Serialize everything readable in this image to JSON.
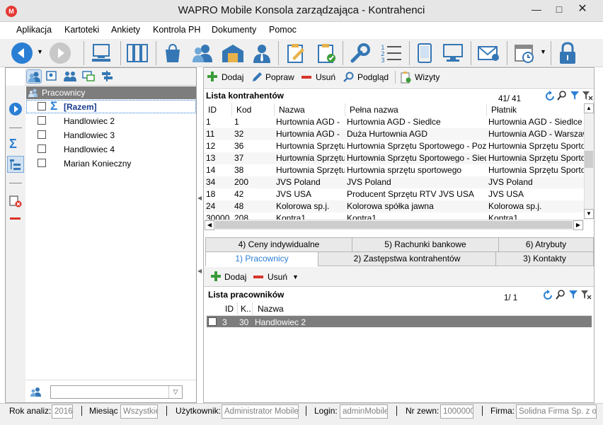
{
  "window": {
    "title": "WAPRO Mobile Konsola zarządzająca - Kontrahenci",
    "logo": "M"
  },
  "menu": [
    "Aplikacja",
    "Kartoteki",
    "Ankiety",
    "Kontrola PH",
    "Dokumenty",
    "Pomoc"
  ],
  "toolbar_icons": [
    "back-icon",
    "forward-icon",
    "terminal-icon",
    "binders-icon",
    "shopping-bag-icon",
    "users-icon",
    "warehouse-icon",
    "user-tie-icon",
    "clipboard-edit-icon",
    "clipboard-check-icon",
    "wrench-icon",
    "numbered-list-icon",
    "mobile-device-icon",
    "computer-icon",
    "mail-user-icon",
    "calendar-clock-icon",
    "lock-icon"
  ],
  "left": {
    "tree_title": "Pracownicy",
    "items": [
      {
        "label": "[Razem]",
        "bold": true
      },
      {
        "label": "Handlowiec 2"
      },
      {
        "label": "Handlowiec 3"
      },
      {
        "label": "Handlowiec 4"
      },
      {
        "label": "Marian Konieczny"
      }
    ],
    "search_value": ""
  },
  "right": {
    "toolbar": {
      "add": "Dodaj",
      "edit": "Popraw",
      "delete": "Usuń",
      "preview": "Podgląd",
      "visits": "Wizyty"
    },
    "contractors": {
      "title": "Lista kontrahentów",
      "count": "41/ 41",
      "columns": [
        "ID",
        "Kod",
        "Nazwa",
        "Pełna nazwa",
        "Płatnik"
      ],
      "rows": [
        [
          "1",
          "1",
          "Hurtownia AGD -",
          "Hurtownia AGD - Siedlce",
          "Hurtownia AGD - Siedlce"
        ],
        [
          "11",
          "32",
          "Hurtownia AGD -",
          "Duża Hurtownia AGD",
          "Hurtownia AGD - Warszawa"
        ],
        [
          "12",
          "36",
          "Hurtownia Sprzętu",
          "Hurtownia Sprzętu Sportowego - Pozn",
          "Hurtownia Sprzętu Sportowe"
        ],
        [
          "13",
          "37",
          "Hurtownia Sprzętu",
          "Hurtownia Sprzętu Sportowego - Siedl",
          "Hurtownia Sprzętu Sportowe"
        ],
        [
          "14",
          "38",
          "Hurtownia Sprzętu",
          "Hurtownia sprzętu sportowego",
          "Hurtownia Sprzętu Sportowe"
        ],
        [
          "34",
          "200",
          "JVS Poland",
          "JVS Poland",
          "JVS Poland"
        ],
        [
          "18",
          "42",
          "JVS USA",
          "Producent Sprzętu RTV JVS USA",
          "JVS USA"
        ],
        [
          "24",
          "48",
          "Kolorowa sp.j.",
          "Kolorowa spółka jawna",
          "Kolorowa sp.j."
        ],
        [
          "30000",
          "208",
          "Kontra1",
          "Kontra1",
          "Kontra1"
        ]
      ]
    },
    "tabs_row1": [
      "4) Ceny indywidualne",
      "5) Rachunki bankowe",
      "6) Atrybuty"
    ],
    "tabs_row2": [
      "1) Pracownicy",
      "2) Zastępstwa kontrahentów",
      "3) Kontakty"
    ],
    "sub_toolbar": {
      "add": "Dodaj",
      "delete": "Usuń"
    },
    "employees": {
      "title": "Lista pracowników",
      "count": "1/ 1",
      "columns": [
        "ID",
        "K..",
        "Nazwa"
      ],
      "rows": [
        [
          "3",
          "30",
          "Handlowiec 2"
        ]
      ]
    }
  },
  "status": {
    "year_label": "Rok analiz:",
    "year_value": "2016",
    "month_label": "Miesiąc",
    "month_value": "Wszystkie",
    "user_label": "Użytkownik:",
    "user_value": "Administrator Mobile",
    "login_label": "Login:",
    "login_value": "adminMobile",
    "ext_label": "Nr zewn:",
    "ext_value": "1000000",
    "company_label": "Firma:",
    "company_value": "Solidna Firma Sp. z o.o."
  },
  "colors": {
    "accent_blue": "#2a7fd4",
    "selection_gray": "#7d7d7d",
    "delete_red": "#d9342b",
    "add_green": "#3a9c3a"
  }
}
